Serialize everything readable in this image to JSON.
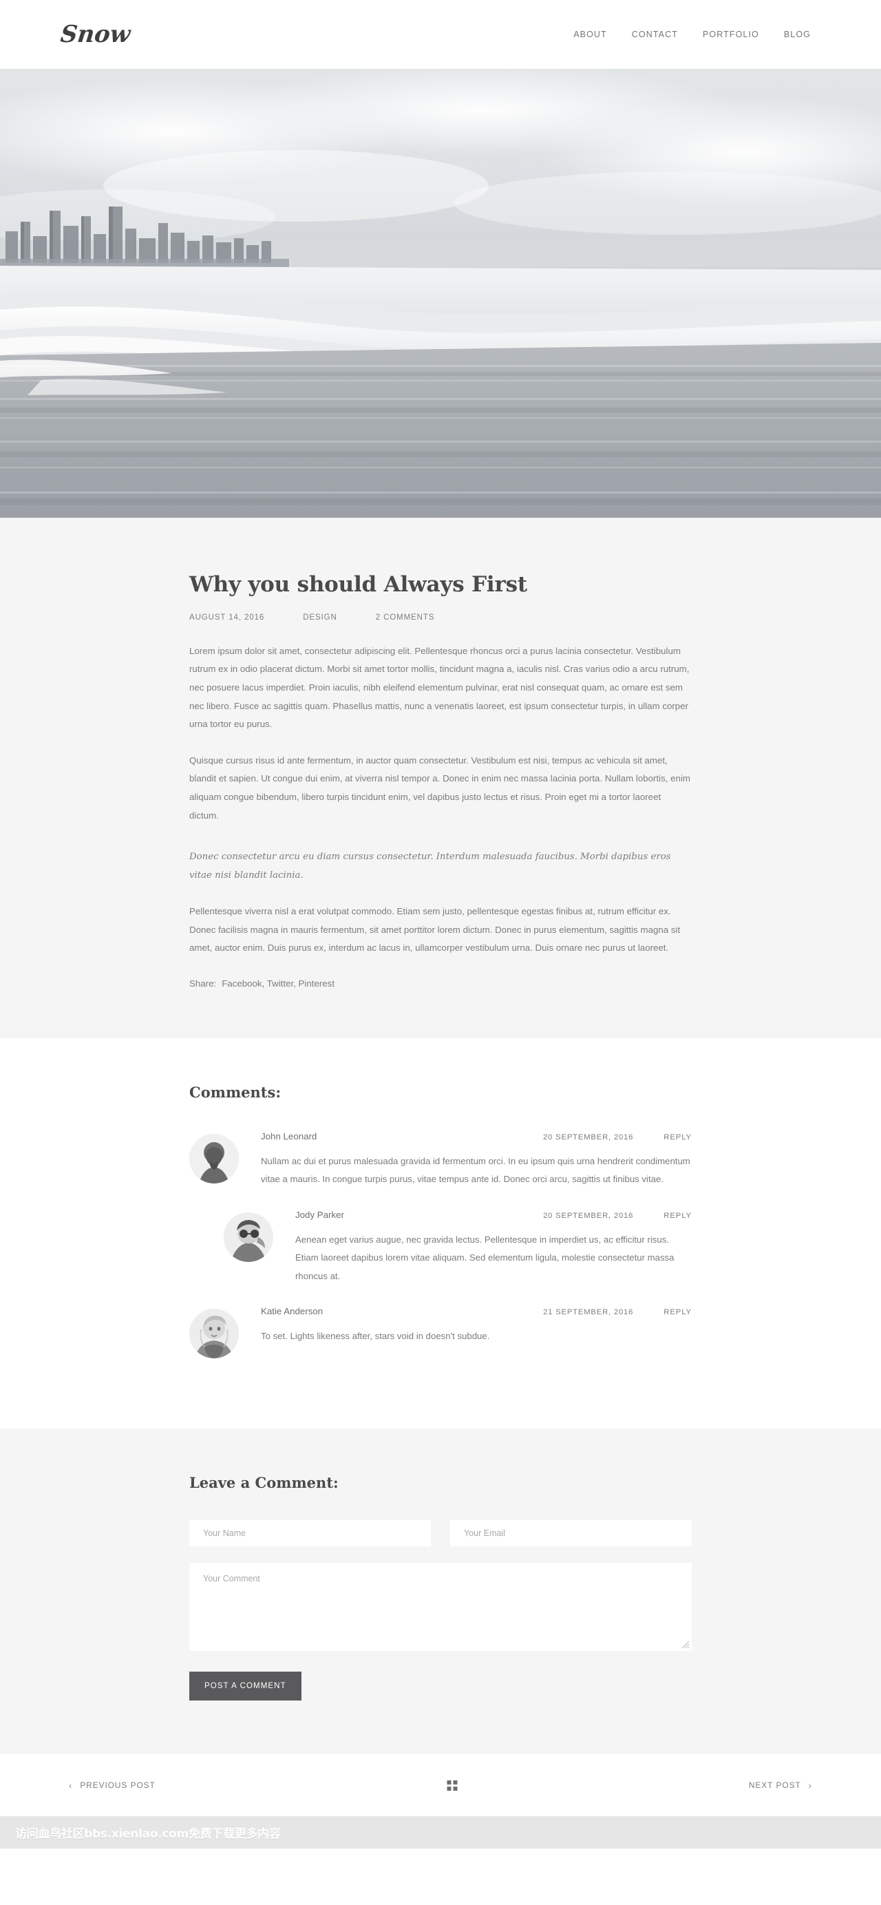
{
  "header": {
    "logo": "Snow",
    "nav": [
      {
        "label": "ABOUT"
      },
      {
        "label": "CONTACT"
      },
      {
        "label": "PORTFOLIO"
      },
      {
        "label": "BLOG"
      }
    ]
  },
  "hero": {
    "alt": "beach-coastline-photo"
  },
  "post": {
    "title": "Why you should Always First",
    "meta": {
      "date": "AUGUST 14, 2016",
      "category": "DESIGN",
      "comments": "2 COMMENTS"
    },
    "paragraph_1": "Lorem ipsum dolor sit amet, consectetur adipiscing elit. Pellentesque rhoncus orci a purus lacinia consectetur. Vestibulum rutrum ex in odio placerat dictum. Morbi sit amet tortor mollis, tincidunt magna a, iaculis nisl. Cras varius odio a arcu rutrum, nec posuere lacus imperdiet. Proin iaculis, nibh eleifend elementum pulvinar, erat nisl consequat quam, ac ornare est sem nec libero. Fusce ac sagittis quam. Phasellus mattis, nunc a venenatis laoreet, est ipsum consectetur turpis, in ullam corper urna tortor eu purus.",
    "paragraph_2": "Quisque cursus risus id ante fermentum, in auctor quam consectetur. Vestibulum est nisi, tempus ac vehicula sit amet, blandit et sapien. Ut congue dui enim, at viverra nisl tempor a. Donec in enim nec massa lacinia porta. Nullam lobortis, enim aliquam congue bibendum, libero turpis tincidunt enim, vel dapibus justo lectus et risus. Proin eget mi a tortor laoreet dictum.",
    "quote": "Donec consectetur arcu eu diam cursus consectetur. Interdum malesuada faucibus. Morbi dapibus eros vitae nisi blandit lacinia.",
    "paragraph_3": "Pellentesque viverra nisl a erat volutpat commodo. Etiam sem justo, pellentesque egestas finibus at, rutrum efficitur ex. Donec facilisis magna in mauris fermentum, sit amet porttitor lorem dictum. Donec in purus elementum, sagittis magna sit amet, auctor enim. Duis purus ex, interdum ac lacus in, ullamcorper vestibulum urna. Duis ornare nec purus ut laoreet.",
    "share_label": "Share:",
    "share_links": "Facebook, Twitter, Pinterest"
  },
  "comments": {
    "heading": "Comments:",
    "items": [
      {
        "author": "John Leonard",
        "date": "20 SEPTEMBER, 2016",
        "reply": "REPLY",
        "text": "Nullam ac dui et purus malesuada gravida id fermentum orci. In eu ipsum quis urna hendrerit condimentum vitae a mauris. In congue turpis purus, vitae tempus ante id. Donec orci arcu, sagittis ut finibus vitae.",
        "indent": 0,
        "avatar": "avatar-john-leonard"
      },
      {
        "author": "Jody Parker",
        "date": "20 SEPTEMBER, 2016",
        "reply": "REPLY",
        "text": "Aenean eget varius augue, nec gravida lectus. Pellentesque in imperdiet us, ac efficitur risus. Etiam laoreet dapibus lorem vitae aliquam. Sed elementum ligula, molestie consectetur massa rhoncus at.",
        "indent": 1,
        "avatar": "avatar-jody-parker"
      },
      {
        "author": "Katie Anderson",
        "date": "21 SEPTEMBER, 2016",
        "reply": "REPLY",
        "text": "To set. Lights likeness after, stars void in doesn't subdue.",
        "indent": 0,
        "avatar": "avatar-katie-anderson"
      }
    ]
  },
  "comment_form": {
    "heading": "Leave a Comment:",
    "name_placeholder": "Your Name",
    "name_value": "",
    "email_placeholder": "Your Email",
    "email_value": "",
    "comment_placeholder": "Your Comment",
    "comment_value": "",
    "submit_label": "POST A COMMENT"
  },
  "post_nav": {
    "previous": "PREVIOUS POST",
    "next": "NEXT POST",
    "prev_chevron": "‹",
    "next_chevron": "›",
    "grid_icon": "grid-icon"
  },
  "watermark": {
    "text": "访问血鸟社区bbs.xienlao.com免费下载更多内容"
  },
  "colors": {
    "page_bg": "#ffffff",
    "section_bg": "#f5f5f5",
    "text": "#7c7c7c",
    "heading": "#4a4a4a",
    "button_bg": "#5a5a5c",
    "watermark_bar": "#e6e6e6"
  }
}
